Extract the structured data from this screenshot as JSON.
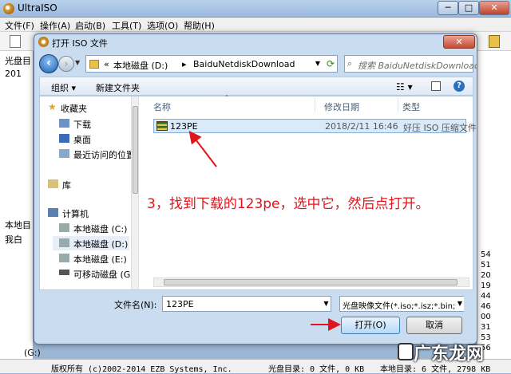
{
  "main_window": {
    "title": "UltraISO",
    "controls": {
      "minimize": "─",
      "maximize": "□",
      "close": "✕"
    },
    "menu": [
      "文件(F)",
      "操作(A)",
      "启动(B)",
      "工具(T)",
      "选项(O)",
      "帮助(H)"
    ],
    "left_labels": [
      "光盘目",
      "201",
      "本地目",
      "我白"
    ],
    "right_numbers": [
      "54",
      "51",
      "20",
      "19",
      "44",
      "46",
      "00",
      "31",
      "53",
      "56"
    ],
    "bottom_drive": "(G:)",
    "status": {
      "copyright": "版权所有 (c)2002-2014 EZB Systems, Inc.",
      "disc_dir": "光盘目录: 0 文件, 0 KB",
      "local_dir": "本地目录: 6 文件, 2798 KB"
    }
  },
  "dialog": {
    "title": "打开 ISO 文件",
    "close_label": "✕",
    "address": {
      "prefix": "«",
      "segments": [
        "本地磁盘 (D:)",
        "BaiduNetdiskDownload"
      ]
    },
    "search_placeholder": "搜索 BaiduNetdiskDownload",
    "cmd": {
      "organize": "组织 ▾",
      "new_folder": "新建文件夹"
    },
    "nav": {
      "favorites": "收藏夹",
      "fav_items": [
        "下载",
        "桌面",
        "最近访问的位置"
      ],
      "libraries": "库",
      "computer": "计算机",
      "drives": [
        "本地磁盘 (C:)",
        "本地磁盘 (D:)",
        "本地磁盘 (E:)",
        "可移动磁盘 (G:)"
      ]
    },
    "columns": {
      "name": "名称",
      "modified": "修改日期",
      "type": "类型"
    },
    "files": [
      {
        "name": "123PE",
        "modified": "2018/2/11 16:46",
        "type": "好压 ISO 压缩文件"
      }
    ],
    "annotation": "3，找到下载的123pe，选中它，然后点打开。",
    "filename_label": "文件名(N):",
    "filename_value": "123PE",
    "filetype_value": "光盘映像文件(*.iso;*.isz;*.bin;*",
    "open_label": "打开(O)",
    "cancel_label": "取消"
  },
  "watermark": "广东龙网",
  "colors": {
    "annotation": "#e0141b",
    "selection": "#d9ebfb"
  }
}
